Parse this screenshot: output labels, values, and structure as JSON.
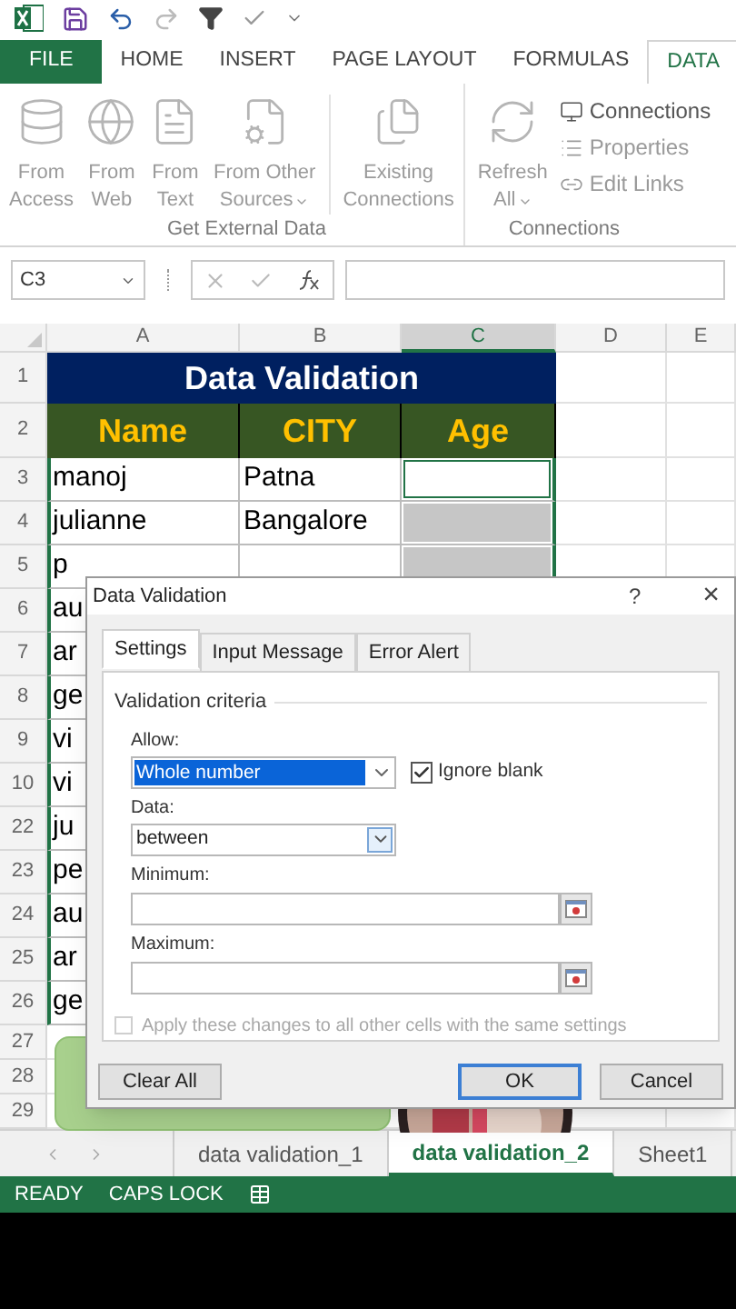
{
  "ribbon_tabs": [
    {
      "label": "FILE",
      "kind": "file",
      "selected": false
    },
    {
      "label": "HOME",
      "kind": "tab",
      "selected": false
    },
    {
      "label": "INSERT",
      "kind": "tab",
      "selected": false
    },
    {
      "label": "PAGE LAYOUT",
      "kind": "tab",
      "selected": false
    },
    {
      "label": "FORMULAS",
      "kind": "tab",
      "selected": false
    },
    {
      "label": "DATA",
      "kind": "tab",
      "selected": true
    }
  ],
  "ribbon_groups": [
    {
      "label": "Get External Data",
      "buttons": [
        {
          "lines": [
            "From",
            "Access"
          ],
          "dropdown": false
        },
        {
          "lines": [
            "From",
            "Web"
          ],
          "dropdown": false
        },
        {
          "lines": [
            "From",
            "Text"
          ],
          "dropdown": false
        },
        {
          "lines": [
            "From Other",
            "Sources"
          ],
          "dropdown": true
        },
        {
          "lines": [
            "Existing",
            "Connections"
          ],
          "dropdown": false
        }
      ]
    },
    {
      "label": "Connections",
      "buttons": [
        {
          "lines": [
            "Refresh",
            "All"
          ],
          "dropdown": true
        }
      ],
      "small_buttons": [
        "Connections",
        "Properties",
        "Edit Links"
      ]
    }
  ],
  "name_box": "C3",
  "columns": [
    {
      "label": "A",
      "selected": false
    },
    {
      "label": "B",
      "selected": false
    },
    {
      "label": "C",
      "selected": true
    },
    {
      "label": "D",
      "selected": false
    },
    {
      "label": "E",
      "selected": false
    }
  ],
  "rows": [
    {
      "header": "1",
      "kind": "title",
      "text": "Data Validation"
    },
    {
      "header": "2",
      "kind": "heading",
      "cells": [
        "Name",
        "CITY",
        "Age"
      ]
    },
    {
      "header": "3",
      "kind": "data",
      "name": "manoj",
      "city": "Patna",
      "age_shaded": false
    },
    {
      "header": "4",
      "kind": "data",
      "name": "julianne",
      "city": "Bangalore",
      "age_shaded": true
    },
    {
      "header": "5",
      "kind": "data",
      "name": "p",
      "age_shaded": true
    },
    {
      "header": "6",
      "kind": "data",
      "name": "au"
    },
    {
      "header": "7",
      "kind": "data",
      "name": "ar"
    },
    {
      "header": "8",
      "kind": "data",
      "name": "ge"
    },
    {
      "header": "9",
      "kind": "data",
      "name": "vi"
    },
    {
      "header": "10",
      "kind": "data",
      "name": "vi"
    },
    {
      "header": "22",
      "kind": "data",
      "name": "ju"
    },
    {
      "header": "23",
      "kind": "data",
      "name": "pe"
    },
    {
      "header": "24",
      "kind": "data",
      "name": "au"
    },
    {
      "header": "25",
      "kind": "data",
      "name": "ar"
    },
    {
      "header": "26",
      "kind": "data",
      "name": "ge"
    },
    {
      "header": "27",
      "kind": "blank"
    },
    {
      "header": "28",
      "kind": "blank"
    },
    {
      "header": "29",
      "kind": "blank"
    }
  ],
  "dialog": {
    "title": "Data Validation",
    "help": "?",
    "close": "×",
    "tabs": [
      {
        "label": "Settings",
        "selected": true
      },
      {
        "label": "Input Message",
        "selected": false
      },
      {
        "label": "Error Alert",
        "selected": false
      }
    ],
    "section": "Validation criteria",
    "allow": {
      "label": "Allow:",
      "value": "Whole number",
      "highlighted": true
    },
    "ignore_blank": {
      "label": "Ignore blank",
      "checked": true
    },
    "data": {
      "label": "Data:",
      "value": "between"
    },
    "minimum": {
      "label": "Minimum:"
    },
    "maximum": {
      "label": "Maximum:"
    },
    "apply_all": {
      "label": "Apply these changes to all other cells with the same settings",
      "checked": false,
      "disabled": true
    },
    "buttons": [
      {
        "label": "Clear All",
        "kind": "left",
        "default": false
      },
      {
        "label": "OK",
        "kind": "right",
        "default": true
      },
      {
        "label": "Cancel",
        "kind": "right",
        "default": false
      }
    ]
  },
  "sheet_tabs": [
    {
      "label": "data validation_1",
      "selected": false
    },
    {
      "label": "data validation_2",
      "selected": true
    },
    {
      "label": "Sheet1",
      "selected": false
    }
  ],
  "status_bar": [
    "READY",
    "CAPS LOCK"
  ]
}
